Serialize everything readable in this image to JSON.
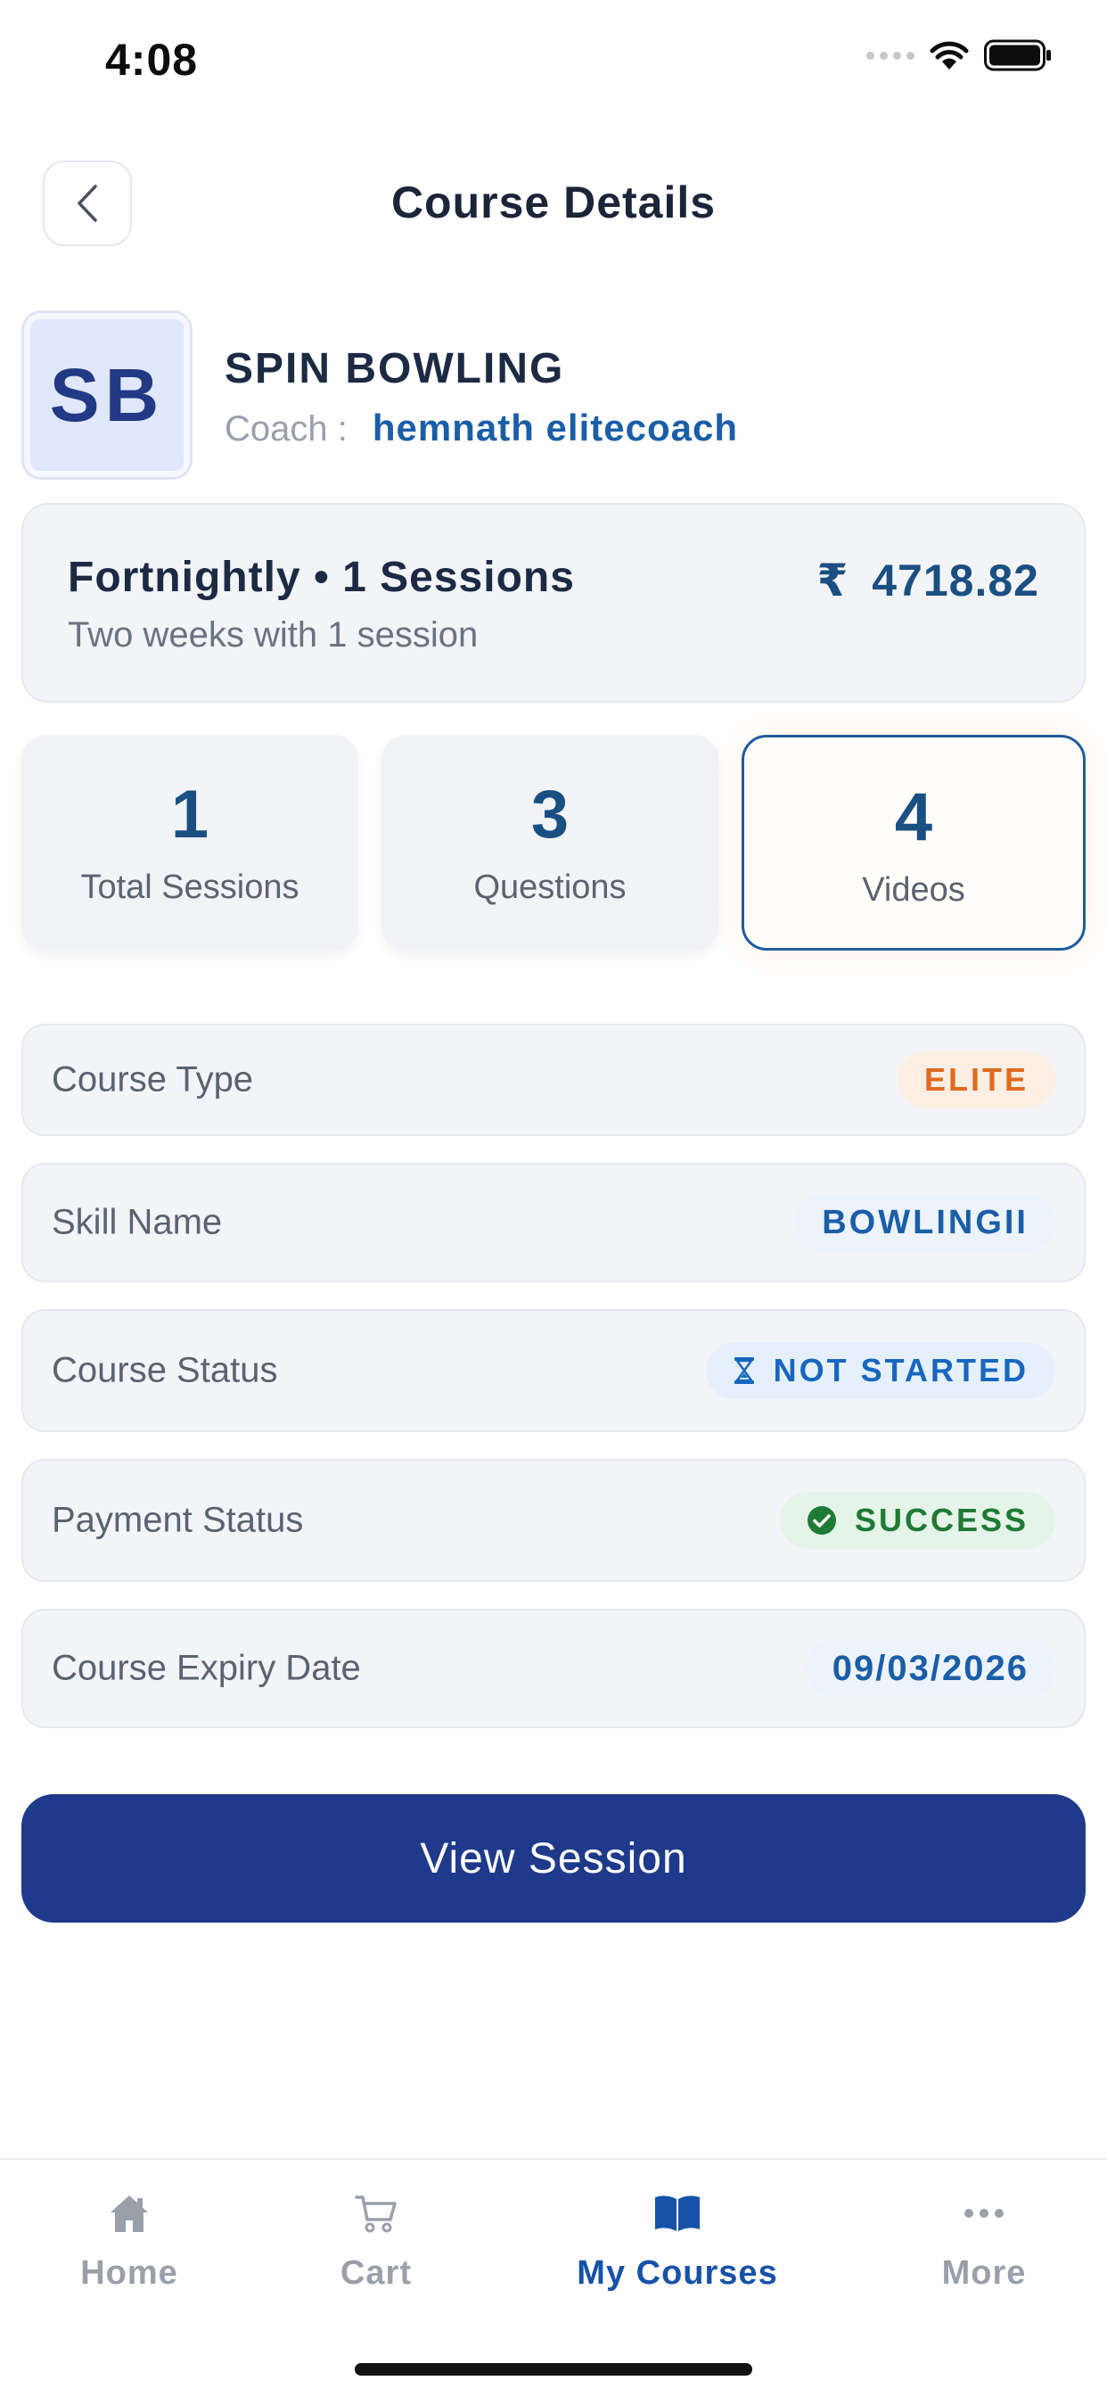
{
  "status_bar": {
    "time": "4:08"
  },
  "header": {
    "title": "Course Details"
  },
  "course": {
    "initials": "SB",
    "name": "SPIN BOWLING",
    "coach_label": "Coach :",
    "coach_name": "hemnath elitecoach"
  },
  "plan": {
    "title": "Fortnightly • 1 Sessions",
    "description": "Two weeks with 1 session",
    "currency": "₹",
    "price": "4718.82"
  },
  "stats": [
    {
      "value": "1",
      "label": "Total Sessions"
    },
    {
      "value": "3",
      "label": "Questions"
    },
    {
      "value": "4",
      "label": "Videos"
    }
  ],
  "details": {
    "course_type": {
      "label": "Course Type",
      "value": "ELITE"
    },
    "skill_name": {
      "label": "Skill Name",
      "value": "BOWLINGII"
    },
    "course_status": {
      "label": "Course Status",
      "value": "NOT STARTED"
    },
    "payment_status": {
      "label": "Payment Status",
      "value": "SUCCESS"
    },
    "expiry_date": {
      "label": "Course Expiry Date",
      "value": "09/03/2026"
    }
  },
  "actions": {
    "view_session_label": "View Session"
  },
  "tab_bar": {
    "items": [
      {
        "label": "Home",
        "icon": "home-icon"
      },
      {
        "label": "Cart",
        "icon": "cart-icon"
      },
      {
        "label": "My Courses",
        "icon": "book-icon",
        "active": true
      },
      {
        "label": "More",
        "icon": "more-icon"
      }
    ]
  },
  "colors": {
    "primary": "#1f3a8a",
    "accent_blue": "#1b5ea8",
    "elite_orange": "#e06a1f",
    "success_green": "#1f7a35"
  }
}
